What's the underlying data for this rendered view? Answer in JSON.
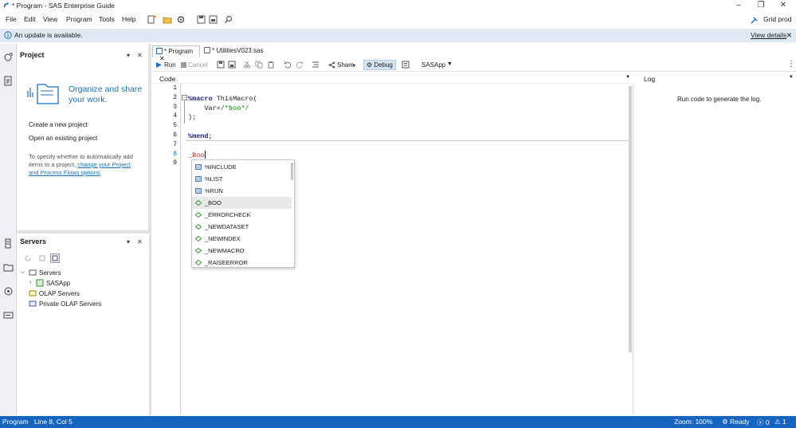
{
  "window": {
    "title": "* Program - SAS Enterprise Guide",
    "profile": "Grid prod",
    "minimize": "–",
    "restore": "❐",
    "close": "✕"
  },
  "menu": {
    "file": "File",
    "edit": "Edit",
    "view": "View",
    "program": "Program",
    "tools": "Tools",
    "help": "Help"
  },
  "notification": {
    "text": "An update is available.",
    "link": "View details",
    "close": "✕"
  },
  "project": {
    "title": "Project",
    "hero": "Organize and share your work.",
    "create": "Create a new project",
    "open": "Open an existing project",
    "note_pre": "To specify whether to automatically add items to a project,",
    "note_link": "change your Project and Process Flows options",
    "note_post": "."
  },
  "servers": {
    "title": "Servers",
    "root": "Servers",
    "items": [
      "SASApp",
      "OLAP Servers",
      "Private OLAP Servers"
    ]
  },
  "tabs": [
    {
      "label": "* Program",
      "close": "✕"
    },
    {
      "label": "* UtilitiesV023.sas"
    }
  ],
  "toolbar": {
    "run": "Run",
    "cancel": "Cancel",
    "share": "Share",
    "debug": "Debug",
    "server": "SASApp"
  },
  "panes": {
    "code": "Code",
    "log": "Log",
    "log_msg": "Run code to generate the log."
  },
  "code": {
    "line_numbers": [
      "1",
      "2",
      "3",
      "4",
      "5",
      "6",
      "7",
      "8",
      "9"
    ],
    "l2_kw": "%macro",
    "l2_rest": " ThisMacro(",
    "l3_a": "    Var=",
    "l3_c": "/*boo*/",
    "l4": ");",
    "l6_kw": "%mend",
    "l6_rest": ";",
    "l8": "_Boo"
  },
  "autocomplete": {
    "items": [
      {
        "label": "%INCLUDE",
        "kind": "statement"
      },
      {
        "label": "%LIST",
        "kind": "statement"
      },
      {
        "label": "%RUN",
        "kind": "statement"
      },
      {
        "label": "_BOO",
        "kind": "macro"
      },
      {
        "label": "_ERRORCHECK",
        "kind": "macro"
      },
      {
        "label": "_NEWDATASET",
        "kind": "macro"
      },
      {
        "label": "_NEWINDEX",
        "kind": "macro"
      },
      {
        "label": "_NEWMACRO",
        "kind": "macro"
      },
      {
        "label": "_RAISEERROR",
        "kind": "macro"
      }
    ],
    "selected": "_BOO"
  },
  "status": {
    "mode": "Program",
    "position": "Line 8, Col 5",
    "zoom": "Zoom: 100%",
    "ready": "Ready",
    "errors": "0",
    "warnings": "1"
  },
  "colors": {
    "accent": "#1565c0",
    "notify_bg": "#dfe9f3",
    "link": "#1f6fb5"
  }
}
